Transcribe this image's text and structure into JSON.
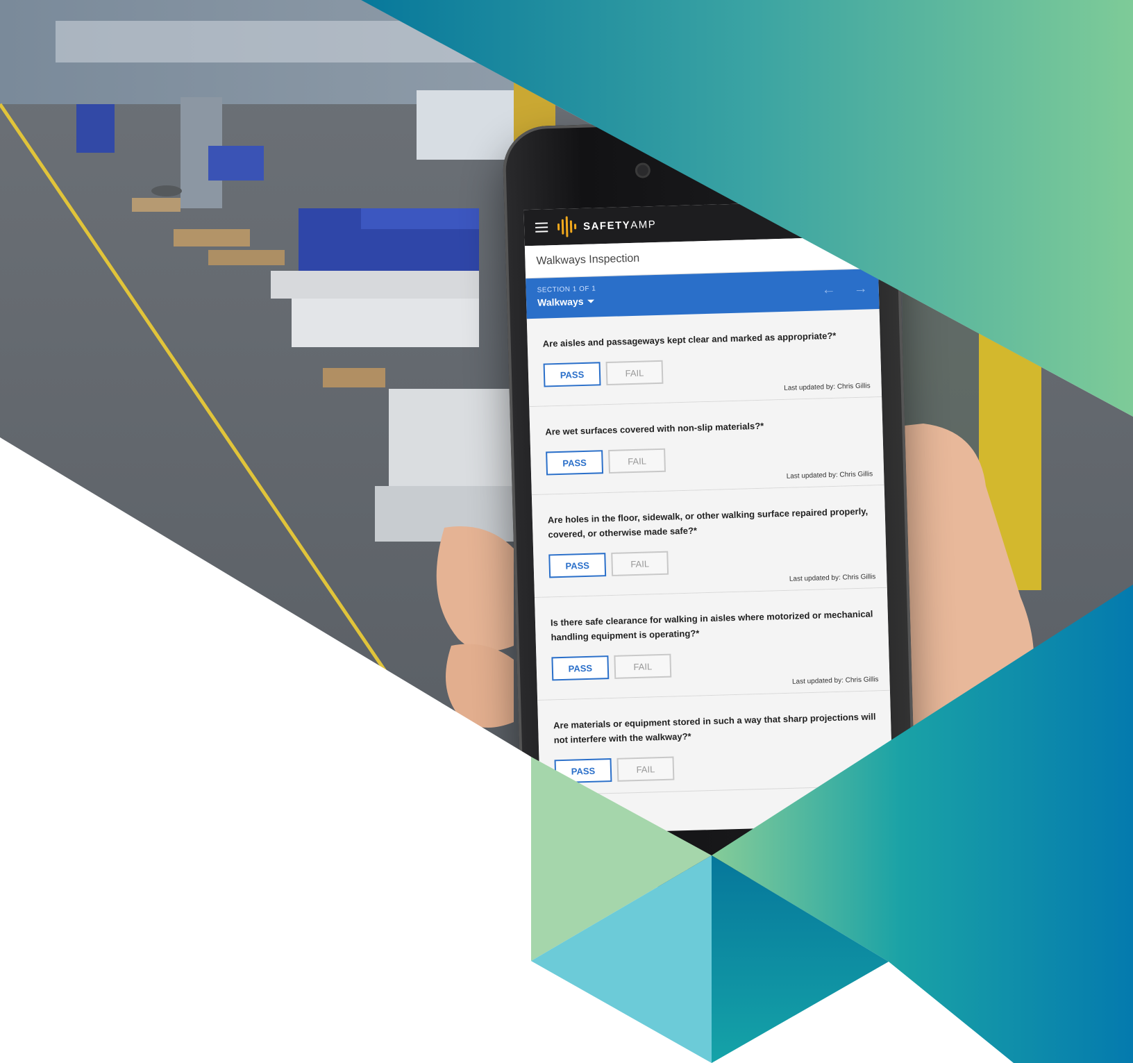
{
  "app": {
    "brand_bold": "SAFETY",
    "brand_light": "AMP",
    "form_title": "Walkways Inspection"
  },
  "section": {
    "label": "SECTION 1 OF 1",
    "name": "Walkways"
  },
  "questions": [
    {
      "text": "Are aisles and passageways kept clear and marked as appropriate?*",
      "pass": "PASS",
      "fail": "FAIL",
      "updated": "Last updated by: Chris Gillis"
    },
    {
      "text": "Are wet surfaces covered with non-slip materials?*",
      "pass": "PASS",
      "fail": "FAIL",
      "updated": "Last updated by: Chris Gillis"
    },
    {
      "text": "Are holes in the floor, sidewalk, or other walking surface repaired properly, covered, or otherwise made safe?*",
      "pass": "PASS",
      "fail": "FAIL",
      "updated": "Last updated by: Chris Gillis"
    },
    {
      "text": "Is there safe clearance for walking in aisles where motorized or mechanical handling equipment is operating?*",
      "pass": "PASS",
      "fail": "FAIL",
      "updated": "Last updated by: Chris Gillis"
    },
    {
      "text": "Are materials or equipment stored in such a way that sharp projections will not interfere with the walkway?*",
      "pass": "PASS",
      "fail": "FAIL",
      "updated": ""
    }
  ],
  "colors": {
    "accent_blue": "#2a6fc9",
    "brand_yellow": "#f2a91d",
    "teal": "#0d8aa5",
    "green": "#7fcb98"
  }
}
